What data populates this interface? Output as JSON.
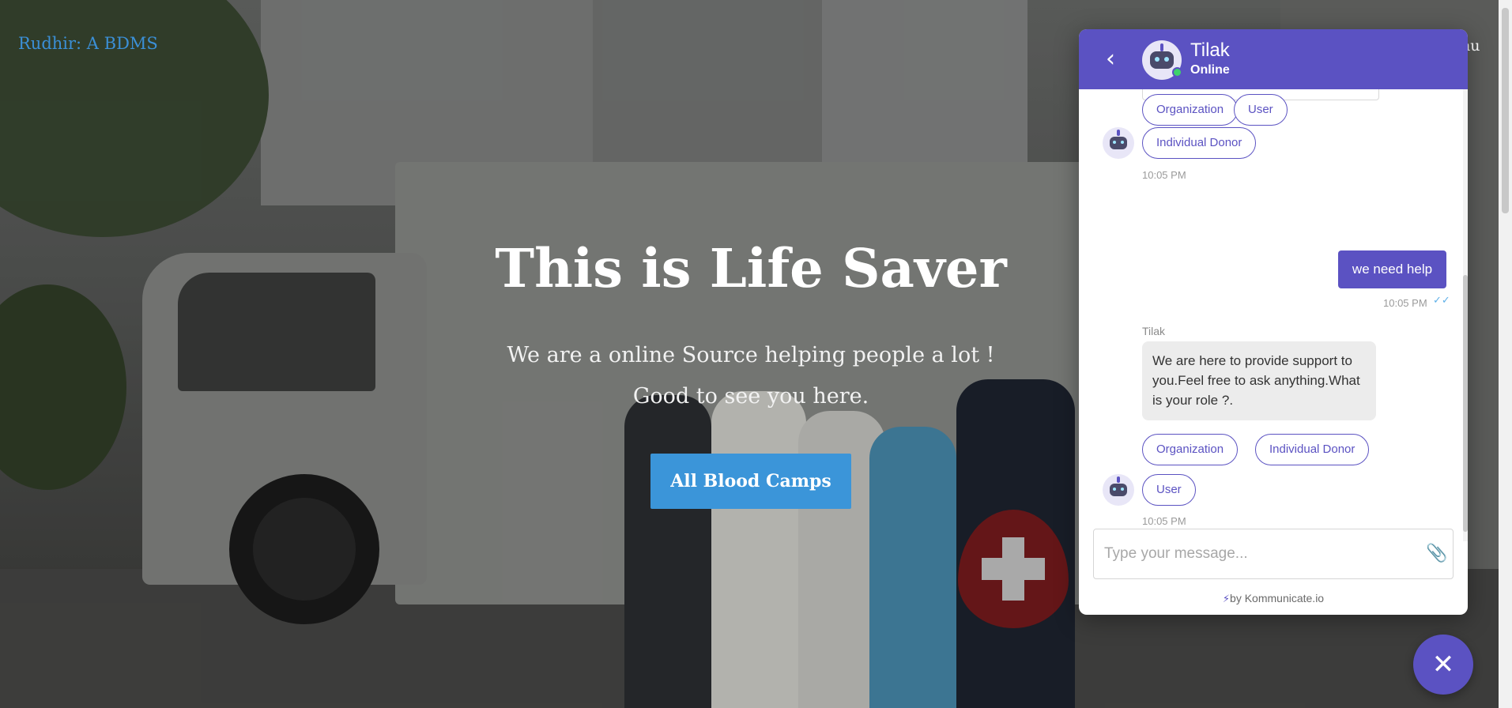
{
  "site": {
    "brand": "Rudhir: A BDMS",
    "nav_peek": "nu"
  },
  "hero": {
    "title": "This is Life Saver",
    "subtitle_line1": "We are a online Source helping people a lot !",
    "subtitle_line2": "Good to see you here.",
    "cta_label": "All Blood Camps"
  },
  "chat": {
    "header": {
      "back_icon": "chevron-left-icon",
      "agent_name": "Tilak",
      "status": "Online"
    },
    "messages": {
      "chips_group1": [
        "Organization",
        "User",
        "Individual Donor"
      ],
      "time1": "10:05 PM",
      "user_message": "we need help",
      "user_time": "10:05 PM",
      "sender": "Tilak",
      "bot_message": "We are here to provide support to you.Feel free to ask anything.What is your role ?.",
      "chips_group2": [
        "Organization",
        "Individual Donor",
        "User"
      ],
      "time2": "10:05 PM"
    },
    "input": {
      "placeholder": "Type your message...",
      "attach_icon": "paperclip-icon"
    },
    "powered_by": "by Kommunicate.io"
  },
  "close_icon": "close-icon",
  "colors": {
    "brand_link": "#3b8fd6",
    "chat_accent": "#5b52c2",
    "cta": "#3b95d9",
    "online": "#3ed36a"
  }
}
